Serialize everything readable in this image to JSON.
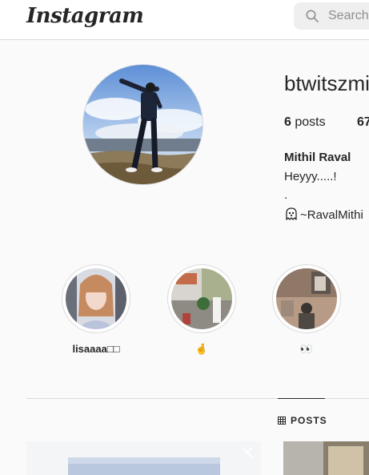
{
  "app": {
    "logo_text": "Instagram"
  },
  "search": {
    "placeholder": "Search"
  },
  "profile": {
    "username": "btwitszmi",
    "posts_count": "6",
    "posts_label": "posts",
    "second_stat_count": "67",
    "full_name": "Mithil Raval",
    "bio_lines": [
      "Heyyy.....!",
      ".",
      "~RavalMithi"
    ],
    "bio_icon": "ghost-icon"
  },
  "highlights": [
    {
      "label": "lisaaaa□□"
    },
    {
      "label": "🤞"
    },
    {
      "label": "👀"
    }
  ],
  "tabs": {
    "posts_label": "POSTS",
    "icon": "grid-icon"
  },
  "colors": {
    "background": "#fafafa",
    "border": "#dbdbdb",
    "text": "#262626",
    "muted": "#8e8e8e"
  }
}
